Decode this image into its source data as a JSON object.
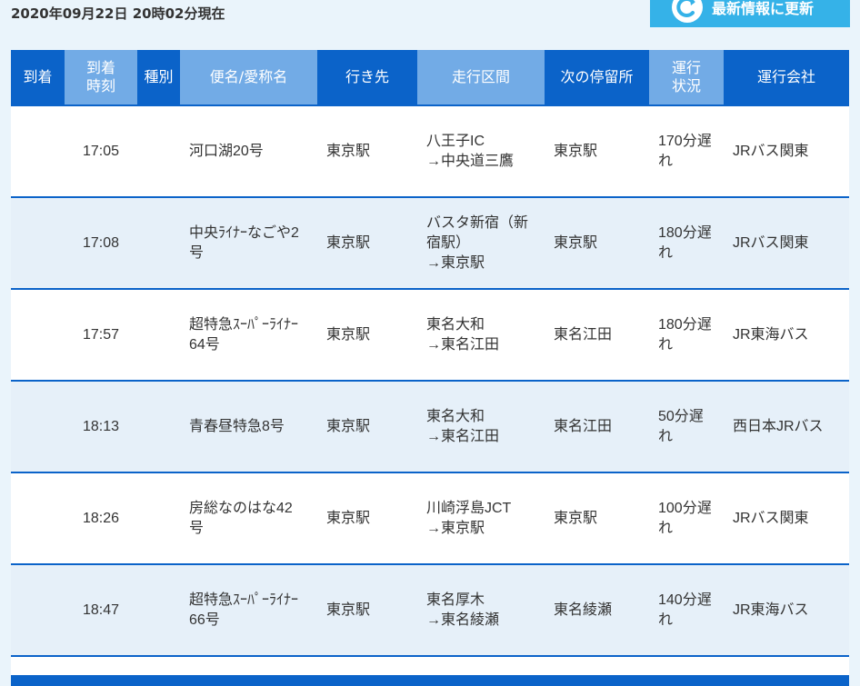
{
  "timestamp": "2020年09月22日 20時02分現在",
  "refresh_button": "最新情報に更新",
  "columns": {
    "arrival": "到着",
    "arrival_time": [
      "到着",
      "時刻"
    ],
    "type": "種別",
    "name": "便名/愛称名",
    "destination": "行き先",
    "section": "走行区間",
    "next_stop": "次の停留所",
    "status": [
      "運行",
      "状況"
    ],
    "operator": "運行会社"
  },
  "rows": [
    {
      "time": "17:05",
      "name": [
        "河口湖20号"
      ],
      "dest": "東京駅",
      "section": [
        "八王子IC",
        "→中央道三鷹"
      ],
      "next": "東京駅",
      "status": [
        "170分遅",
        "れ"
      ],
      "operator": "JRバス関東"
    },
    {
      "time": "17:08",
      "name": [
        "中央ﾗｲﾅｰなごや2",
        "号"
      ],
      "dest": "東京駅",
      "section": [
        "バスタ新宿（新",
        "宿駅）",
        "→東京駅"
      ],
      "next": "東京駅",
      "status": [
        "180分遅",
        "れ"
      ],
      "operator": "JRバス関東"
    },
    {
      "time": "17:57",
      "name": [
        "超特急ｽｰﾊﾟｰﾗｲﾅｰ",
        "64号"
      ],
      "dest": "東京駅",
      "section": [
        "東名大和",
        "→東名江田"
      ],
      "next": "東名江田",
      "status": [
        "180分遅",
        "れ"
      ],
      "operator": "JR東海バス"
    },
    {
      "time": "18:13",
      "name": [
        "青春昼特急8号"
      ],
      "dest": "東京駅",
      "section": [
        "東名大和",
        "→東名江田"
      ],
      "next": "東名江田",
      "status": [
        "50分遅",
        "れ"
      ],
      "operator": "西日本JRバス"
    },
    {
      "time": "18:26",
      "name": [
        "房総なのはな42",
        "号"
      ],
      "dest": "東京駅",
      "section": [
        "川崎浮島JCT",
        "→東京駅"
      ],
      "next": "東京駅",
      "status": [
        "100分遅",
        "れ"
      ],
      "operator": "JRバス関東"
    },
    {
      "time": "18:47",
      "name": [
        "超特急ｽｰﾊﾟｰﾗｲﾅｰ",
        "66号"
      ],
      "dest": "東京駅",
      "section": [
        "東名厚木",
        "→東名綾瀬"
      ],
      "next": "東名綾瀬",
      "status": [
        "140分遅",
        "れ"
      ],
      "operator": "JR東海バス"
    }
  ]
}
